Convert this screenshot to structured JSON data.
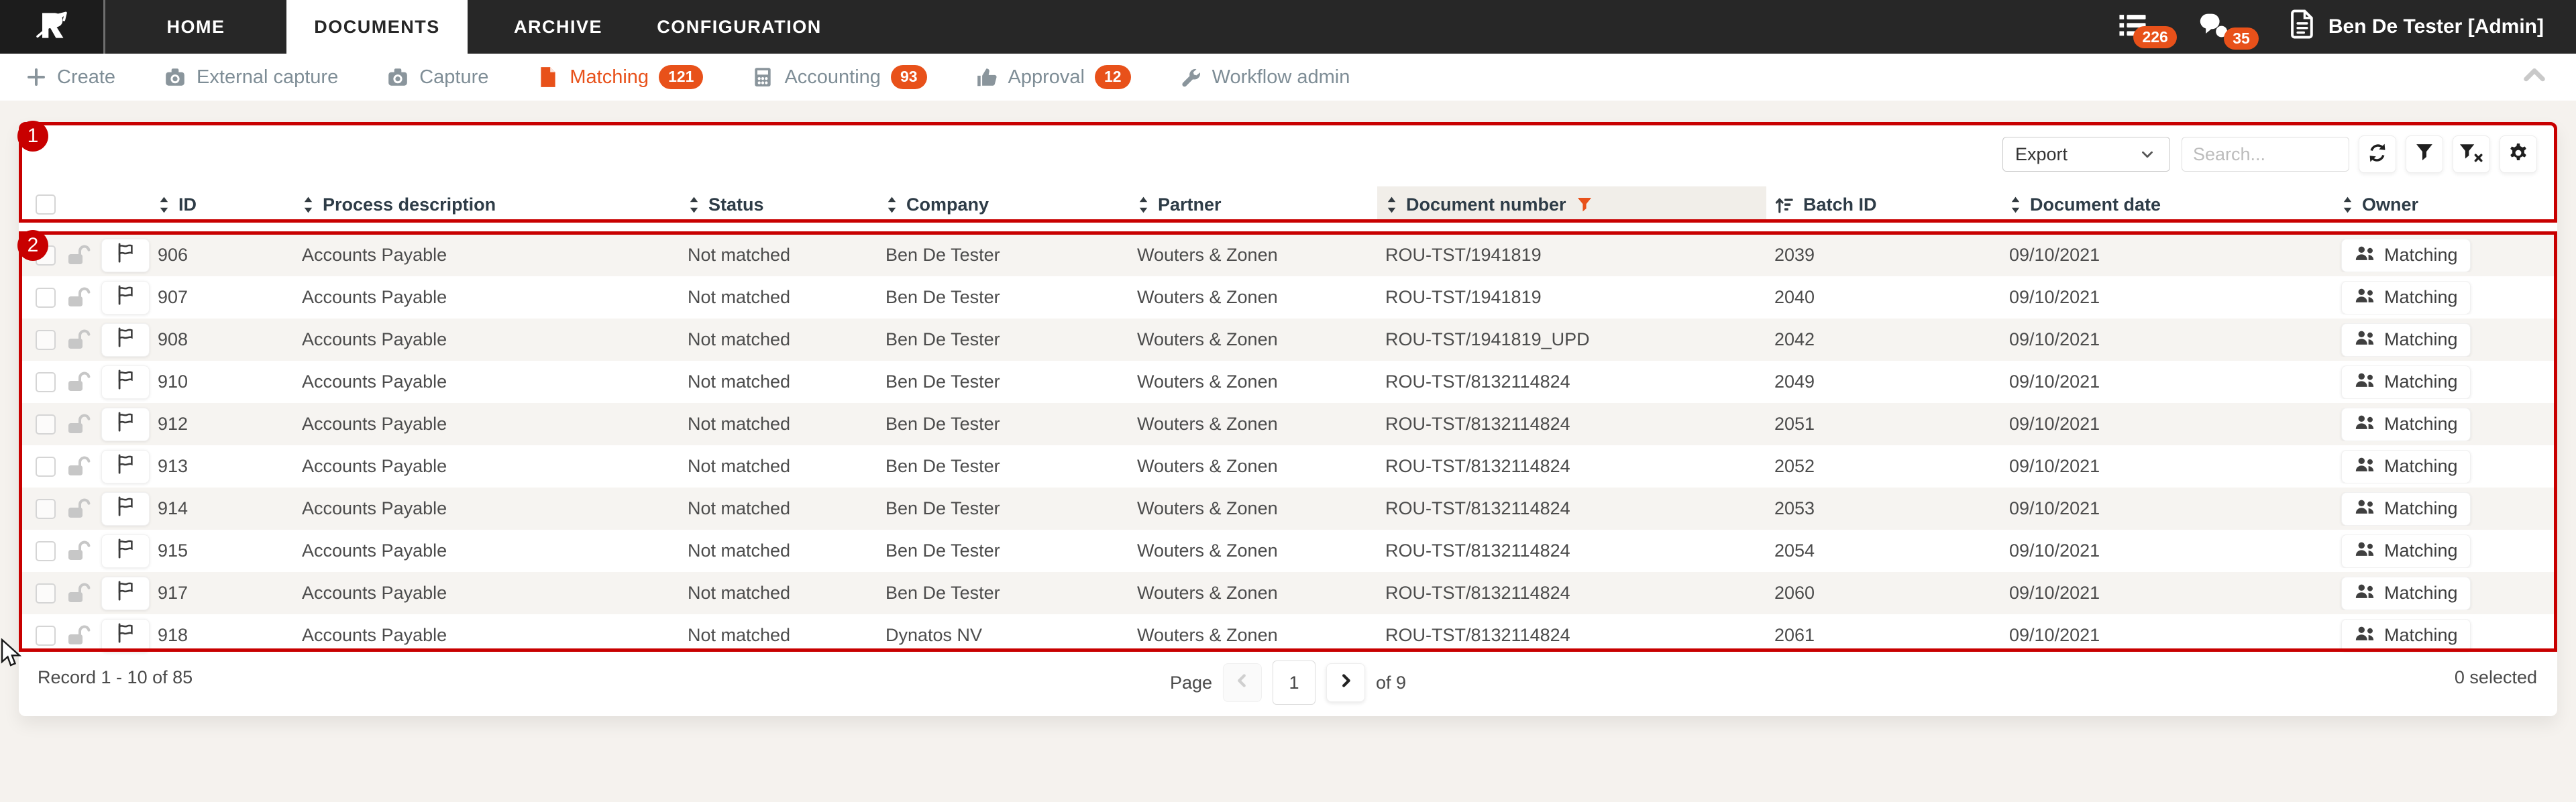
{
  "nav": {
    "tabs": [
      {
        "label": "HOME"
      },
      {
        "label": "DOCUMENTS"
      },
      {
        "label": "ARCHIVE"
      },
      {
        "label": "CONFIGURATION"
      }
    ],
    "notifications": [
      {
        "name": "task-list",
        "count": "226"
      },
      {
        "name": "messages",
        "count": "35"
      }
    ],
    "user_name": "Ben De Tester [Admin]"
  },
  "toolbar": {
    "items": [
      {
        "label": "Create"
      },
      {
        "label": "External capture"
      },
      {
        "label": "Capture"
      },
      {
        "label": "Matching",
        "badge": "121"
      },
      {
        "label": "Accounting",
        "badge": "93"
      },
      {
        "label": "Approval",
        "badge": "12"
      },
      {
        "label": "Workflow admin"
      }
    ]
  },
  "controls": {
    "export_label": "Export",
    "search_placeholder": "Search..."
  },
  "table": {
    "columns": [
      {
        "label": "ID"
      },
      {
        "label": "Process description"
      },
      {
        "label": "Status"
      },
      {
        "label": "Company"
      },
      {
        "label": "Partner"
      },
      {
        "label": "Document number",
        "filtered": true
      },
      {
        "label": "Batch ID",
        "sorted": "asc"
      },
      {
        "label": "Document date"
      },
      {
        "label": "Owner"
      }
    ],
    "rows": [
      {
        "id": "906",
        "process": "Accounts Payable",
        "status": "Not matched",
        "company": "Ben De Tester",
        "partner": "Wouters & Zonen",
        "document_number": "ROU-TST/1941819",
        "batch_id": "2039",
        "document_date": "09/10/2021",
        "owner": "Matching"
      },
      {
        "id": "907",
        "process": "Accounts Payable",
        "status": "Not matched",
        "company": "Ben De Tester",
        "partner": "Wouters & Zonen",
        "document_number": "ROU-TST/1941819",
        "batch_id": "2040",
        "document_date": "09/10/2021",
        "owner": "Matching"
      },
      {
        "id": "908",
        "process": "Accounts Payable",
        "status": "Not matched",
        "company": "Ben De Tester",
        "partner": "Wouters & Zonen",
        "document_number": "ROU-TST/1941819_UPD",
        "batch_id": "2042",
        "document_date": "09/10/2021",
        "owner": "Matching"
      },
      {
        "id": "910",
        "process": "Accounts Payable",
        "status": "Not matched",
        "company": "Ben De Tester",
        "partner": "Wouters & Zonen",
        "document_number": "ROU-TST/8132114824",
        "batch_id": "2049",
        "document_date": "09/10/2021",
        "owner": "Matching"
      },
      {
        "id": "912",
        "process": "Accounts Payable",
        "status": "Not matched",
        "company": "Ben De Tester",
        "partner": "Wouters & Zonen",
        "document_number": "ROU-TST/8132114824",
        "batch_id": "2051",
        "document_date": "09/10/2021",
        "owner": "Matching"
      },
      {
        "id": "913",
        "process": "Accounts Payable",
        "status": "Not matched",
        "company": "Ben De Tester",
        "partner": "Wouters & Zonen",
        "document_number": "ROU-TST/8132114824",
        "batch_id": "2052",
        "document_date": "09/10/2021",
        "owner": "Matching"
      },
      {
        "id": "914",
        "process": "Accounts Payable",
        "status": "Not matched",
        "company": "Ben De Tester",
        "partner": "Wouters & Zonen",
        "document_number": "ROU-TST/8132114824",
        "batch_id": "2053",
        "document_date": "09/10/2021",
        "owner": "Matching"
      },
      {
        "id": "915",
        "process": "Accounts Payable",
        "status": "Not matched",
        "company": "Ben De Tester",
        "partner": "Wouters & Zonen",
        "document_number": "ROU-TST/8132114824",
        "batch_id": "2054",
        "document_date": "09/10/2021",
        "owner": "Matching"
      },
      {
        "id": "917",
        "process": "Accounts Payable",
        "status": "Not matched",
        "company": "Ben De Tester",
        "partner": "Wouters & Zonen",
        "document_number": "ROU-TST/8132114824",
        "batch_id": "2060",
        "document_date": "09/10/2021",
        "owner": "Matching"
      },
      {
        "id": "918",
        "process": "Accounts Payable",
        "status": "Not matched",
        "company": "Dynatos NV",
        "partner": "Wouters & Zonen",
        "document_number": "ROU-TST/8132114824",
        "batch_id": "2061",
        "document_date": "09/10/2021",
        "owner": "Matching"
      }
    ]
  },
  "footer": {
    "record_text": "Record 1 - 10 of 85",
    "page_label": "Page",
    "page_value": "1",
    "of_label": "of 9",
    "selected_text": "0 selected"
  },
  "annotations": {
    "badge1": "1",
    "badge2": "2"
  },
  "colors": {
    "accent": "#E8511A",
    "annotation_red": "#C80000",
    "nav_bg": "#272727"
  }
}
